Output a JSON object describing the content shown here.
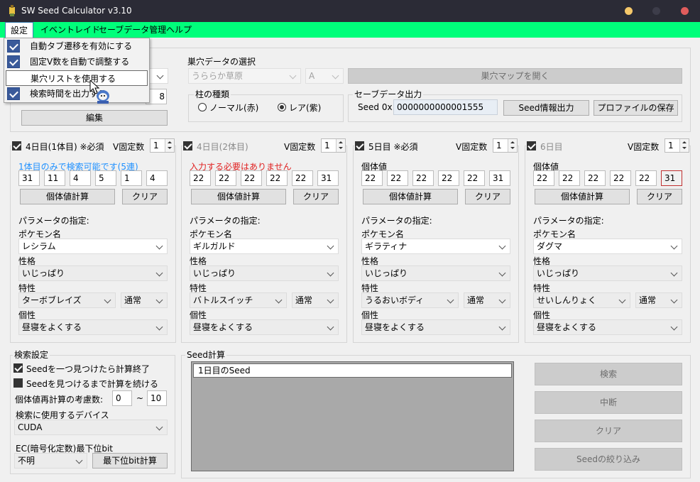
{
  "window": {
    "title": "SW Seed Calculator v3.10"
  },
  "menu": {
    "items": [
      "設定",
      "イベントレイド",
      "セーブデータ管理",
      "ヘルプ"
    ],
    "dropdown": [
      {
        "label": "自動タブ遷移を有効にする",
        "checked": true
      },
      {
        "label": "固定V数を自動で調整する",
        "checked": true
      },
      {
        "label": "巣穴リストを使用する",
        "checked": false
      },
      {
        "label": "検索時間を出力する",
        "checked": true
      }
    ]
  },
  "den": {
    "legend": "巣穴データの選択",
    "left_combo_value": "",
    "left_num_value": "8",
    "calc_button": "編集",
    "place": "うららか草原",
    "rank": "A",
    "map_button": "巣穴マップを開く",
    "pillar_legend": "柱の種類",
    "pillar_normal": "ノーマル(赤)",
    "pillar_rare": "レア(紫)",
    "save_legend": "セーブデータ出力",
    "seed_label": "Seed 0x",
    "seed_value": "0000000000001555",
    "seed_info_button": "Seed情報出力",
    "profile_button": "プロファイルの保存"
  },
  "columns": [
    {
      "title": "4日目(1体目) ※必須",
      "checked": true,
      "vfix_label": "V固定数",
      "vfix": "1",
      "note": "1体目のみで検索可能です(5連)",
      "note_color": "#1e90ff",
      "ivs": [
        "31",
        "11",
        "4",
        "5",
        "1",
        "4"
      ],
      "ivcalc": "個体値計算",
      "clear": "クリア",
      "param": "パラメータの指定:",
      "pokemon_label": "ポケモン名",
      "pokemon": "レシラム",
      "nature_label": "性格",
      "nature": "いじっぱり",
      "ability_label": "特性",
      "ability": "ターボブレイズ",
      "ability_type": "通常",
      "char_label": "個性",
      "char": "昼寝をよくする"
    },
    {
      "title": "4日目(2体目)",
      "checked": true,
      "vfix_label": "V固定数",
      "vfix": "1",
      "note": "入力する必要はありません",
      "note_color": "#e02020",
      "ivs": [
        "22",
        "22",
        "22",
        "22",
        "22",
        "31"
      ],
      "ivcalc": "個体値計算",
      "clear": "クリア",
      "param": "パラメータの指定:",
      "pokemon_label": "ポケモン名",
      "pokemon": "ギルガルド",
      "nature_label": "性格",
      "nature": "いじっぱり",
      "ability_label": "特性",
      "ability": "バトルスイッチ",
      "ability_type": "通常",
      "char_label": "個性",
      "char": "昼寝をよくする"
    },
    {
      "title": "5日目 ※必須",
      "checked": true,
      "vfix_label": "V固定数",
      "vfix": "1",
      "note": "個体値",
      "note_color": "#000000",
      "ivs": [
        "22",
        "22",
        "22",
        "22",
        "22",
        "31"
      ],
      "ivcalc": "個体値計算",
      "clear": "クリア",
      "param": "パラメータの指定:",
      "pokemon_label": "ポケモン名",
      "pokemon": "ギラティナ",
      "nature_label": "性格",
      "nature": "いじっぱり",
      "ability_label": "特性",
      "ability": "うるおいボディ",
      "ability_type": "通常",
      "char_label": "個性",
      "char": "昼寝をよくする"
    },
    {
      "title": "6日目",
      "checked": true,
      "vfix_label": "V固定数",
      "vfix": "1",
      "note": "個体値",
      "note_color": "#000000",
      "ivs": [
        "22",
        "22",
        "22",
        "22",
        "22",
        "31"
      ],
      "ivcalc": "個体値計算",
      "clear": "クリア",
      "param": "パラメータの指定:",
      "pokemon_label": "ポケモン名",
      "pokemon": "ダグマ",
      "nature_label": "性格",
      "nature": "いじっぱり",
      "ability_label": "特性",
      "ability": "せいしんりょく",
      "ability_type": "通常",
      "char_label": "個性",
      "char": "昼寝をよくする"
    }
  ],
  "search": {
    "legend": "検索設定",
    "stop_label": "Seedを一つ見つけたら計算終了",
    "continue_label": "Seedを見つけるまで計算を続ける",
    "recalc_label": "個体値再計算の考慮数:",
    "recalc_from": "0",
    "tilde": "~",
    "recalc_to": "10",
    "device_label": "検索に使用するデバイス",
    "device": "CUDA",
    "ec_label": "EC(暗号化定数)最下位bit",
    "ec_value": "不明",
    "ec_button": "最下位bit計算"
  },
  "seedcalc": {
    "legend": "Seed計算",
    "list_header": "1日目のSeed",
    "buttons": [
      "検索",
      "中断",
      "クリア",
      "Seedの絞り込み"
    ]
  }
}
